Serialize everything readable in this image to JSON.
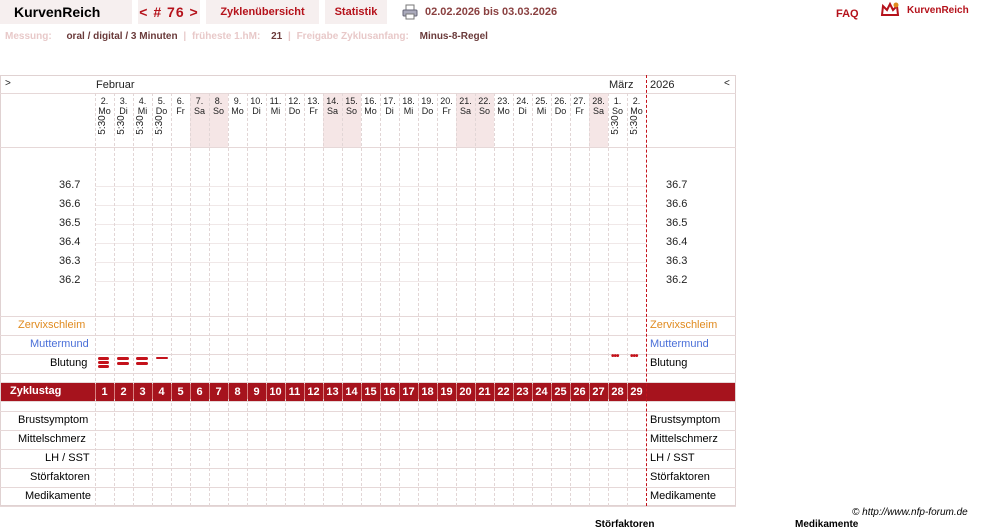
{
  "header": {
    "brand": "KurvenReich",
    "cycle_nav": "< # 76 >",
    "overview_tab": "Zyklenübersicht",
    "stats_tab": "Statistik",
    "date_range": "02.02.2026 bis 03.03.2026",
    "faq": "FAQ",
    "logo_text": "KurvenReich"
  },
  "info": {
    "measure_label": "Messung:",
    "measure_value": "oral / digital / 3 Minuten",
    "earliest_label": "früheste 1.hM:",
    "earliest_value": "21",
    "release_label": "Freigabe Zyklusanfang:",
    "release_value": "Minus-8-Regel"
  },
  "chart": {
    "left_arrow": ">",
    "right_arrow": "<",
    "month_start": "Februar",
    "month_end": "März",
    "year": "2026",
    "temps": [
      "36.7",
      "36.6",
      "36.5",
      "36.4",
      "36.3",
      "36.2"
    ],
    "row_labels": {
      "zervix": "Zervixschleim",
      "mutter": "Muttermund",
      "blutung": "Blutung",
      "zyklustag": "Zyklustag",
      "brust": "Brustsymptom",
      "mittel": "Mittelschmerz",
      "lh": "LH / SST",
      "stoer": "Störfaktoren",
      "medi": "Medikamente"
    },
    "colors": {
      "accent": "#a6131d",
      "zervix": "#e08a1e",
      "mutter": "#4a6fd8",
      "weekend": "#f5e6e6"
    },
    "days": [
      {
        "d": "2.",
        "w": "Mo",
        "t": "5:30",
        "n": "1"
      },
      {
        "d": "3.",
        "w": "Di",
        "t": "5:30",
        "n": "2"
      },
      {
        "d": "4.",
        "w": "Mi",
        "t": "5:30",
        "n": "3"
      },
      {
        "d": "5.",
        "w": "Do",
        "t": "5:30",
        "n": "4"
      },
      {
        "d": "6.",
        "w": "Fr",
        "t": "",
        "n": "5"
      },
      {
        "d": "7.",
        "w": "Sa",
        "t": "",
        "n": "6"
      },
      {
        "d": "8.",
        "w": "So",
        "t": "",
        "n": "7"
      },
      {
        "d": "9.",
        "w": "Mo",
        "t": "",
        "n": "8"
      },
      {
        "d": "10.",
        "w": "Di",
        "t": "",
        "n": "9"
      },
      {
        "d": "11.",
        "w": "Mi",
        "t": "",
        "n": "10"
      },
      {
        "d": "12.",
        "w": "Do",
        "t": "",
        "n": "11"
      },
      {
        "d": "13.",
        "w": "Fr",
        "t": "",
        "n": "12"
      },
      {
        "d": "14.",
        "w": "Sa",
        "t": "",
        "n": "13"
      },
      {
        "d": "15.",
        "w": "So",
        "t": "",
        "n": "14"
      },
      {
        "d": "16.",
        "w": "Mo",
        "t": "",
        "n": "15"
      },
      {
        "d": "17.",
        "w": "Di",
        "t": "",
        "n": "16"
      },
      {
        "d": "18.",
        "w": "Mi",
        "t": "",
        "n": "17"
      },
      {
        "d": "19.",
        "w": "Do",
        "t": "",
        "n": "18"
      },
      {
        "d": "20.",
        "w": "Fr",
        "t": "",
        "n": "19"
      },
      {
        "d": "21.",
        "w": "Sa",
        "t": "",
        "n": "20"
      },
      {
        "d": "22.",
        "w": "So",
        "t": "",
        "n": "21"
      },
      {
        "d": "23.",
        "w": "Mo",
        "t": "",
        "n": "22"
      },
      {
        "d": "24.",
        "w": "Di",
        "t": "",
        "n": "23"
      },
      {
        "d": "25.",
        "w": "Mi",
        "t": "",
        "n": "24"
      },
      {
        "d": "26.",
        "w": "Do",
        "t": "",
        "n": "25"
      },
      {
        "d": "27.",
        "w": "Fr",
        "t": "",
        "n": "26"
      },
      {
        "d": "28.",
        "w": "Sa",
        "t": "",
        "n": "27"
      },
      {
        "d": "1.",
        "w": "So",
        "t": "5:30",
        "n": "28"
      },
      {
        "d": "2.",
        "w": "Mo",
        "t": "5:30",
        "n": "29"
      }
    ],
    "weekend_indices": [
      5,
      6,
      12,
      13,
      19,
      20,
      26
    ],
    "bleeding": [
      {
        "day": 1,
        "type": "heavy"
      },
      {
        "day": 2,
        "type": "medium"
      },
      {
        "day": 3,
        "type": "medium"
      },
      {
        "day": 4,
        "type": "light"
      },
      {
        "day": 28,
        "type": "spotting"
      },
      {
        "day": 29,
        "type": "spotting"
      }
    ]
  },
  "footer": {
    "copyright": "© http://www.nfp-forum.de",
    "clipped_1": "Störfaktoren",
    "clipped_2": "Medikamente"
  }
}
